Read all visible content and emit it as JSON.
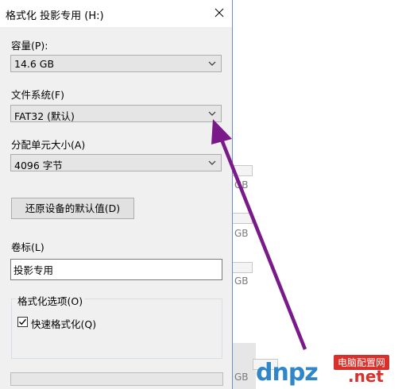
{
  "window": {
    "title": "格式化 投影专用 (H:)"
  },
  "capacity": {
    "label": "容量(P):",
    "value": "14.6 GB"
  },
  "filesystem": {
    "label": "文件系统(F)",
    "value": "FAT32 (默认)"
  },
  "allocation": {
    "label": "分配单元大小(A)",
    "value": "4096 字节"
  },
  "restore_button": {
    "label": "还原设备的默认值(D)"
  },
  "volume_label": {
    "label": "卷标(L)",
    "value": "投影专用"
  },
  "format_options": {
    "title": "格式化选项(O)",
    "quick_format": {
      "label": "快速格式化(Q)",
      "checked": true
    }
  },
  "background": {
    "fragments": [
      "GB",
      "GB",
      "GB",
      "GB"
    ]
  },
  "watermark": {
    "brand": "dnpz",
    "badge": "电脑配置网",
    "tld": ".net"
  },
  "colors": {
    "annotation_arrow": "#7a1a8a",
    "title_border": "#6b8dc7"
  }
}
